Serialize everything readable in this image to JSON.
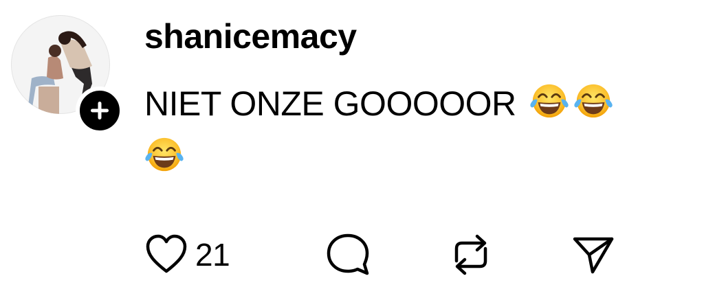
{
  "post": {
    "username": "shanicemacy",
    "text": "NIET ONZE GOOOOOR",
    "text_emojis": [
      "face-with-tears-of-joy",
      "face-with-tears-of-joy",
      "face-with-tears-of-joy"
    ]
  },
  "avatar": {
    "follow_icon": "plus-icon"
  },
  "actions": {
    "like_icon": "heart-icon",
    "like_count": "21",
    "comment_icon": "comment-icon",
    "repost_icon": "repost-icon",
    "share_icon": "send-icon"
  },
  "colors": {
    "text": "#000000",
    "badge_background": "#000000",
    "background": "#ffffff"
  }
}
